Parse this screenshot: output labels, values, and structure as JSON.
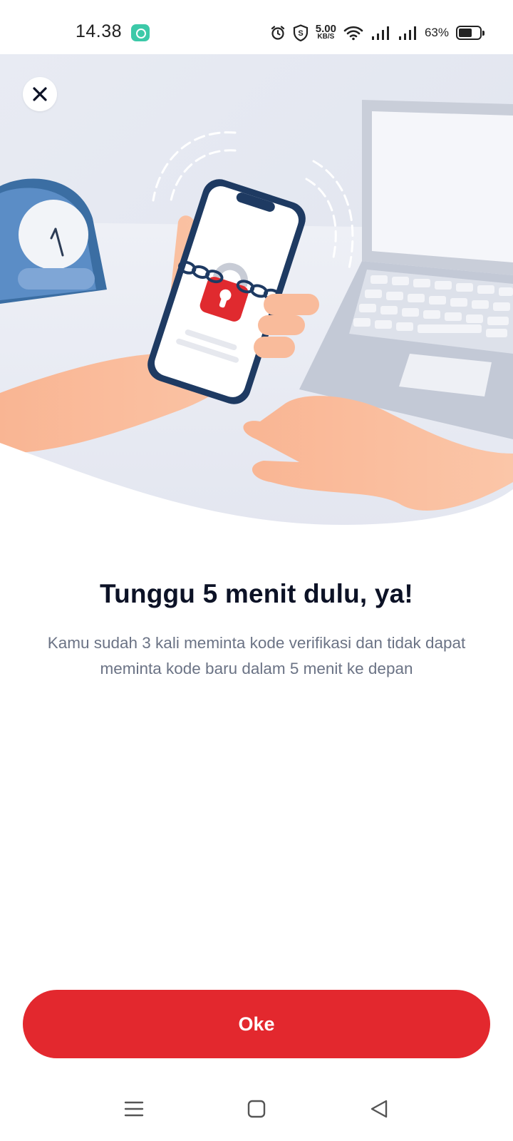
{
  "status_bar": {
    "time": "14.38",
    "net_speed_value": "5.00",
    "net_speed_unit": "KB/S",
    "battery_percent_text": "63%",
    "battery_level": 0.63,
    "icons": [
      "chat-app-icon",
      "alarm-icon",
      "shield-s-icon",
      "wifi-icon",
      "signal-icon",
      "signal-icon",
      "battery-icon"
    ]
  },
  "illustration": {
    "icon": "locked-phone-illustration",
    "close_icon": "close-icon"
  },
  "dialog": {
    "title": "Tunggu 5 menit dulu, ya!",
    "description": "Kamu sudah 3 kali meminta kode verifikasi dan tidak dapat meminta kode baru dalam 5 menit ke depan",
    "ok_label": "Oke"
  },
  "nav_bar": {
    "icons": [
      "menu-icon",
      "home-icon",
      "back-icon"
    ]
  },
  "colors": {
    "accent": "#e3282e",
    "title": "#0c1226",
    "body_text": "#6b7385",
    "background": "#ffffff"
  }
}
